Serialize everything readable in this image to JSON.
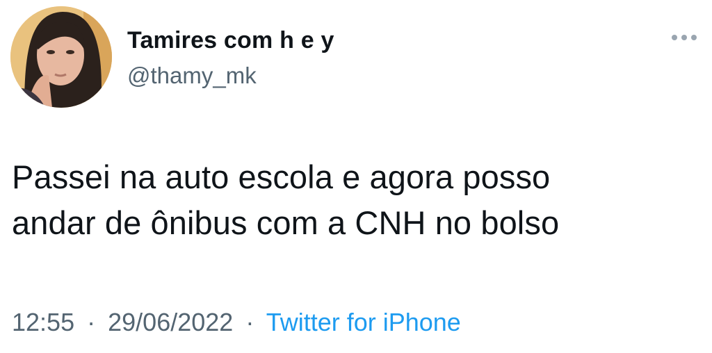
{
  "author": {
    "display_name": "Tamires com h e y",
    "handle": "@thamy_mk",
    "avatar": "profile-photo"
  },
  "more_menu": {
    "icon": "more-horizontal-icon"
  },
  "tweet": {
    "text": "Passei na auto escola e agora posso\nandar de ônibus com a CNH no bolso"
  },
  "meta": {
    "time": "12:55",
    "date": "29/06/2022",
    "separator": "·",
    "source": "Twitter for iPhone"
  },
  "colors": {
    "text": "#0f1419",
    "secondary": "#536471",
    "link": "#1d9bf0",
    "more_dots": "#9aa5b0"
  }
}
